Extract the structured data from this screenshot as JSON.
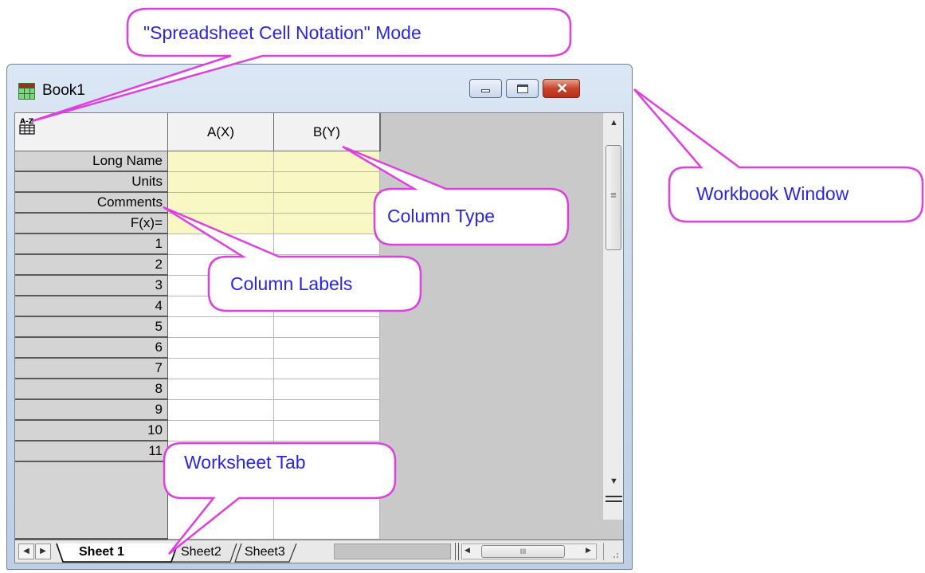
{
  "window": {
    "title": "Book1",
    "close_glyph": "✕"
  },
  "grid": {
    "corner_icon": "spreadsheet-cell-notation-icon",
    "columns": [
      "A(X)",
      "B(Y)"
    ],
    "label_rows": [
      "Long Name",
      "Units",
      "Comments",
      "F(x)="
    ],
    "data_rows": [
      "1",
      "2",
      "3",
      "4",
      "5",
      "6",
      "7",
      "8",
      "9",
      "10",
      "11"
    ]
  },
  "scrollbar": {
    "up_arrow": "▲",
    "down_arrow": "▼",
    "grip": "≡"
  },
  "tabs": {
    "nav_prev": "◀",
    "nav_next": "▶",
    "sheets": [
      "Sheet 1",
      "Sheet2",
      "Sheet3"
    ],
    "active_index": 0,
    "hscroll_left": "◀",
    "hscroll_right": "▶",
    "hscroll_grip": "III"
  },
  "callouts": {
    "notation_mode": "\"Spreadsheet Cell Notation\" Mode",
    "workbook_window": "Workbook Window",
    "column_type": "Column Type",
    "column_labels": "Column Labels",
    "worksheet_tab": "Worksheet Tab"
  },
  "colors": {
    "callout_fill": "#ffffff",
    "callout_stroke": "#e03fe0",
    "callout_text": "#2a25e0",
    "label_row_fill": "#f9f7c3"
  }
}
